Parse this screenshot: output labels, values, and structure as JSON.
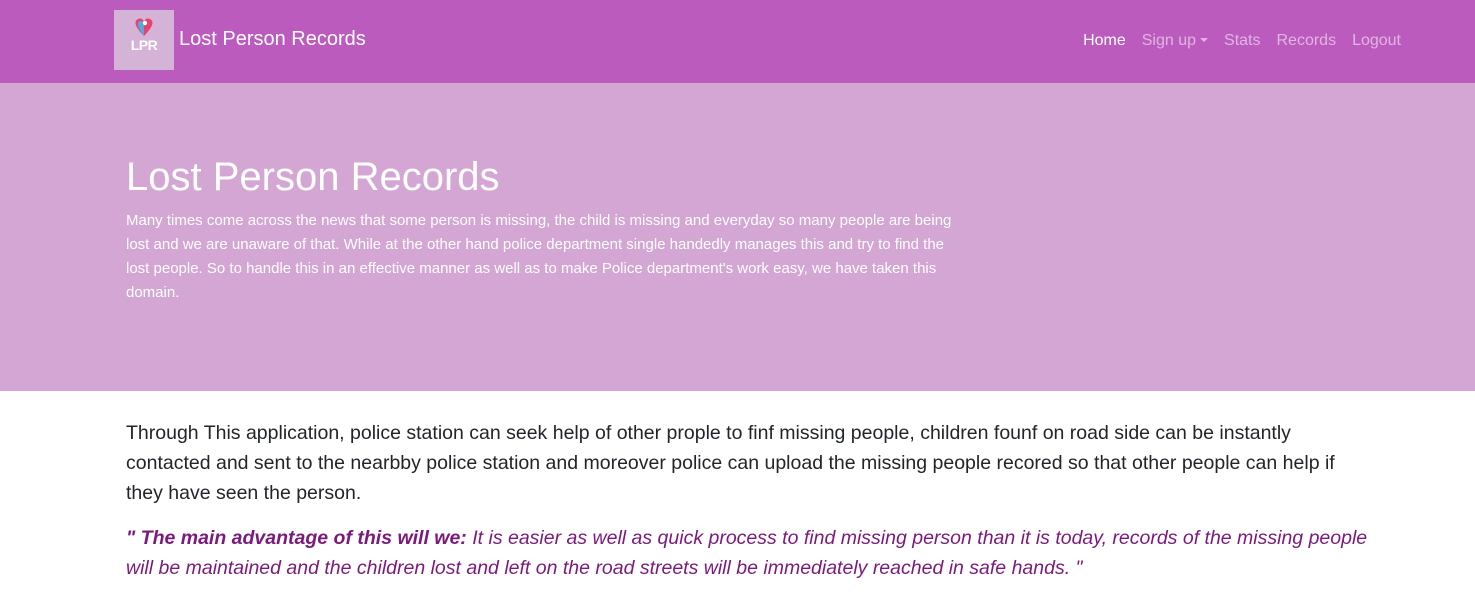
{
  "navbar": {
    "logo_text": "LPR",
    "brand_name": "Lost Person Records",
    "links": [
      {
        "label": "Home"
      },
      {
        "label": "Sign up"
      },
      {
        "label": "Stats"
      },
      {
        "label": "Records"
      },
      {
        "label": "Logout"
      }
    ]
  },
  "jumbotron": {
    "title": "Lost Person Records",
    "description": "Many times come across the news that some person is missing, the child is missing and everyday so many people are being lost and we are unaware of that. While at the other hand police department single handedly manages this and try to find the lost people. So to handle this in an effective manner as well as to make Police department's work easy, we have taken this domain."
  },
  "main": {
    "paragraph": "Through This application, police station can seek help of other prople to finf missing people, children founf on road side can be instantly contacted and sent to the nearbby police station and moreover police can upload the missing people recored so that other people can help if they have seen the person.",
    "quote_lead": "\" The main advantage of this will we:",
    "quote_body": " It is easier as well as quick process to find missing person than it is today, records of the missing people will be maintained and the children lost and left on the road streets will be immediately reached in safe hands. \""
  },
  "colors": {
    "navbar_bg": "#bb5bbd",
    "jumbotron_bg": "#d3a6d4",
    "quote_color": "#7a1a7c"
  }
}
